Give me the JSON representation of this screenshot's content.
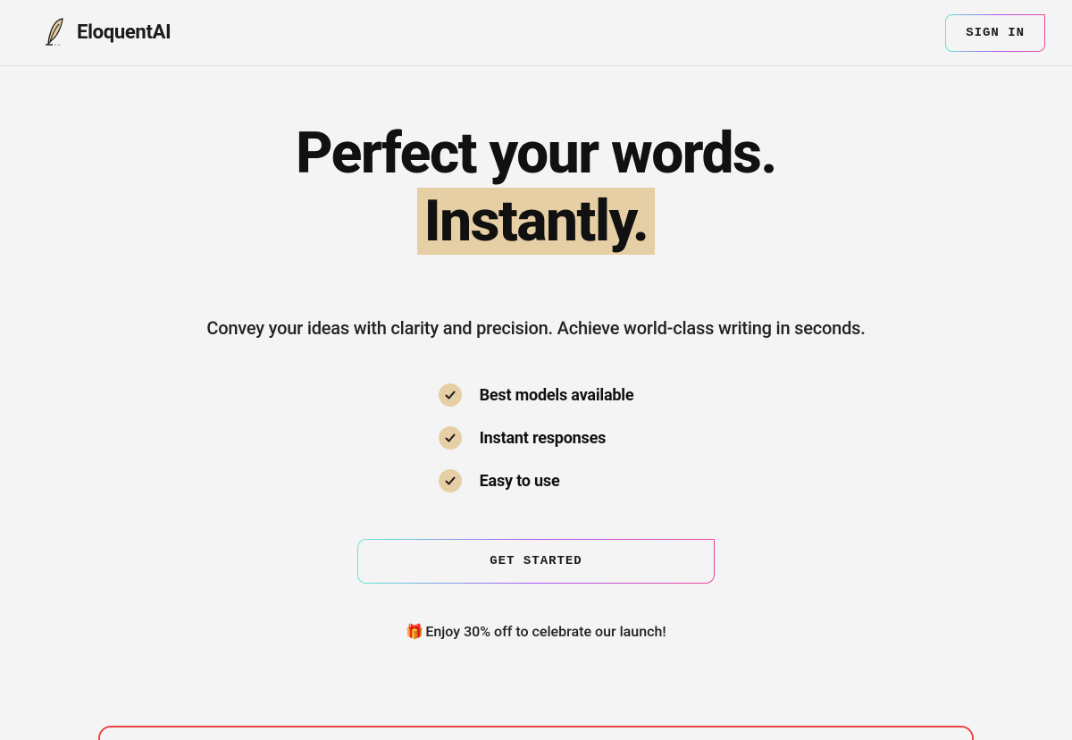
{
  "header": {
    "brand": "EloquentAI",
    "sign_in_label": "SIGN IN"
  },
  "hero": {
    "headline_line1": "Perfect your words.",
    "headline_line2": "Instantly.",
    "subtitle": "Convey your ideas with clarity and precision. Achieve world-class writing in seconds.",
    "features": [
      "Best models available",
      "Instant responses",
      "Easy to use"
    ],
    "cta_label": "GET STARTED",
    "promo_icon": "🎁",
    "promo_text": "Enjoy 30% off to celebrate our launch!"
  }
}
